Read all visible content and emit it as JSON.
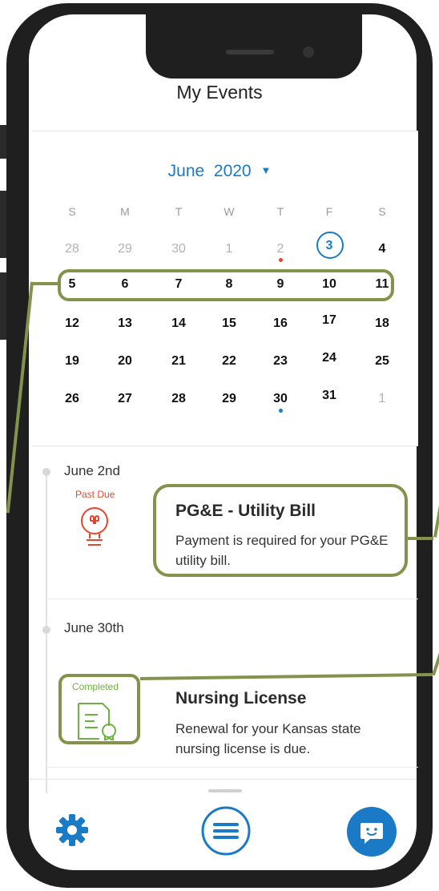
{
  "header": {
    "title": "My Events"
  },
  "calendar": {
    "month": "June",
    "year": "2020",
    "weekdays": [
      "S",
      "M",
      "T",
      "W",
      "T",
      "F",
      "S"
    ],
    "weeks": [
      [
        "28",
        "29",
        "30",
        "1",
        "2",
        "3",
        "4"
      ],
      [
        "5",
        "6",
        "7",
        "8",
        "9",
        "10",
        "11"
      ],
      [
        "12",
        "13",
        "14",
        "15",
        "16",
        "17",
        "18"
      ],
      [
        "19",
        "20",
        "21",
        "22",
        "23",
        "24",
        "25"
      ],
      [
        "26",
        "27",
        "28",
        "29",
        "30",
        "31",
        "1"
      ]
    ],
    "today": "3",
    "colors": {
      "accent": "#1b7ac6",
      "past_due_dot": "#e8452d",
      "highlight": "#84934c"
    }
  },
  "events": [
    {
      "date": "June 2nd",
      "status": "Past Due",
      "icon": "lightbulb-icon",
      "title": "PG&E - Utility Bill",
      "description": "Payment is required for your PG&E utility bill."
    },
    {
      "date": "June 30th",
      "status": "Completed",
      "icon": "certificate-icon",
      "title": "Nursing License",
      "description": "Renewal for your Kansas state nursing license is due."
    }
  ],
  "nav": {
    "settings_icon": "gear-icon",
    "menu_icon": "menu-icon",
    "chat_icon": "chat-icon"
  }
}
